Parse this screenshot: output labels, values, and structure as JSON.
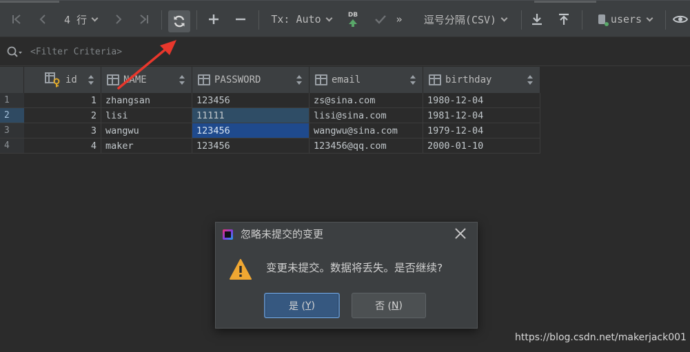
{
  "toolbar": {
    "row_count": "4 行",
    "tx_mode": "Tx: Auto",
    "db_badge": "DB",
    "more": "»",
    "export_format": "逗号分隔(CSV)",
    "table_name": "users"
  },
  "filter": {
    "placeholder": "<Filter Criteria>"
  },
  "grid": {
    "columns": [
      "id",
      "NAME",
      "PASSWORD",
      "email",
      "birthday"
    ],
    "rows": [
      {
        "rn": "1",
        "id": "1",
        "name": "zhangsan",
        "password": "123456",
        "email": "zs@sina.com",
        "birthday": "1980-12-04"
      },
      {
        "rn": "2",
        "id": "2",
        "name": "lisi",
        "password": "11111",
        "email": "lisi@sina.com",
        "birthday": "1981-12-04"
      },
      {
        "rn": "3",
        "id": "3",
        "name": "wangwu",
        "password": "123456",
        "email": "wangwu@sina.com",
        "birthday": "1979-12-04"
      },
      {
        "rn": "4",
        "id": "4",
        "name": "maker",
        "password": "123456",
        "email": "123456@qq.com",
        "birthday": "2000-01-10"
      }
    ]
  },
  "dialog": {
    "title": "忽略未提交的变更",
    "message": "变更未提交。数据将丢失。是否继续?",
    "yes_label": "是 (",
    "yes_key": "Y",
    "yes_end": ")",
    "no_label": "否 (",
    "no_key": "N",
    "no_end": ")"
  },
  "watermark": "https://blog.csdn.net/makerjack001",
  "colors": {
    "background": "#2b2b2b",
    "toolbar": "#3c3f41",
    "selection_strong": "#1f4a8d",
    "selection_light": "#2f4d66",
    "annotation_arrow": "#e8372c",
    "warning": "#f0a732"
  }
}
